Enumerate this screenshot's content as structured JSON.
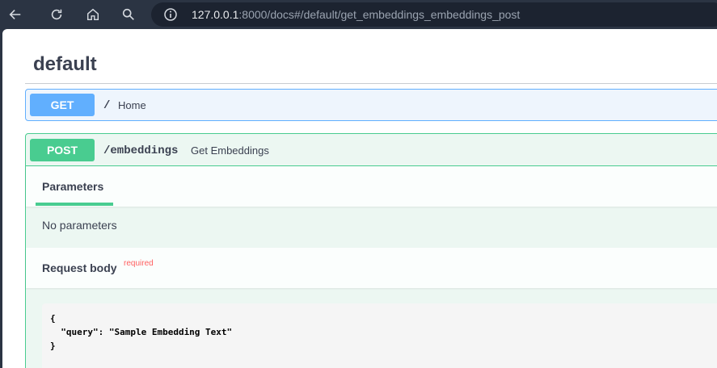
{
  "browser": {
    "url_host": "127.0.0.1",
    "url_rest": ":8000/docs#/default/get_embeddings_embeddings_post",
    "icons": [
      "back-arrow-icon",
      "reload-icon",
      "home-icon",
      "search-icon",
      "info-icon"
    ]
  },
  "page": {
    "tag_title": "default",
    "operations": [
      {
        "method": "GET",
        "path": "/",
        "summary": "Home",
        "color": "#61affe"
      },
      {
        "method": "POST",
        "path": "/embeddings",
        "summary": "Get Embeddings",
        "color": "#49cc90"
      }
    ],
    "parameters_tab": "Parameters",
    "no_parameters": "No parameters",
    "request_body_label": "Request body",
    "required_label": "required",
    "example_code": "{\n  \"query\": \"Sample Embedding Text\"\n}"
  }
}
